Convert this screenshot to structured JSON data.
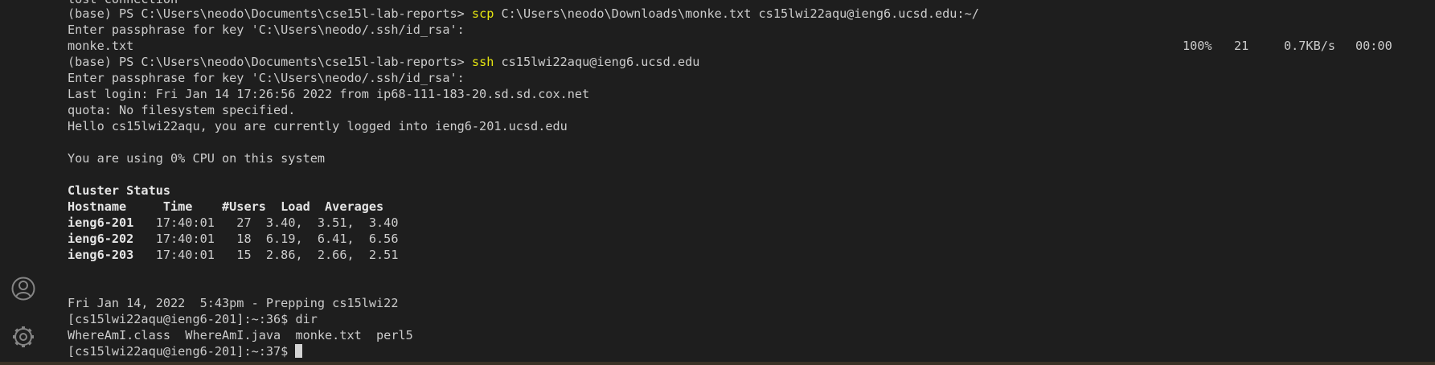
{
  "activity_bar": {
    "icons": [
      "account-icon",
      "settings-gear-icon"
    ]
  },
  "terminal": {
    "top_cut_line": "lost connection",
    "scp_prompt": "(base) PS C:\\Users\\neodo\\Documents\\cse15l-lab-reports>",
    "scp_cmd": "scp",
    "scp_args": "C:\\Users\\neodo\\Downloads\\monke.txt cs15lwi22aqu@ieng6.ucsd.edu:~/",
    "passphrase_1": "Enter passphrase for key 'C:\\Users\\neodo/.ssh/id_rsa':",
    "transfer_file": "monke.txt",
    "transfer_stats": {
      "percent": "100%",
      "bytes": "21",
      "rate": "0.7KB/s",
      "eta": "00:00"
    },
    "ssh_prompt": "(base) PS C:\\Users\\neodo\\Documents\\cse15l-lab-reports>",
    "ssh_cmd": "ssh",
    "ssh_args": "cs15lwi22aqu@ieng6.ucsd.edu",
    "passphrase_2": "Enter passphrase for key 'C:\\Users\\neodo/.ssh/id_rsa':",
    "last_login": "Last login: Fri Jan 14 17:26:56 2022 from ip68-111-183-20.sd.sd.cox.net",
    "quota": "quota: No filesystem specified.",
    "hello": "Hello cs15lwi22aqu, you are currently logged into ieng6-201.ucsd.edu",
    "cpu": "You are using 0% CPU on this system",
    "cluster_title": "Cluster Status",
    "cluster_header": "Hostname     Time    #Users  Load  Averages",
    "cluster_rows": [
      {
        "host": "ieng6-201",
        "rest": "   17:40:01   27  3.40,  3.51,  3.40"
      },
      {
        "host": "ieng6-202",
        "rest": "   17:40:01   18  6.19,  6.41,  6.56"
      },
      {
        "host": "ieng6-203",
        "rest": "   17:40:01   15  2.86,  2.66,  2.51"
      }
    ],
    "prepping": "Fri Jan 14, 2022  5:43pm - Prepping cs15lwi22",
    "prompt_36": "[cs15lwi22aqu@ieng6-201]:~:36$ dir",
    "dir_output": "WhereAmI.class  WhereAmI.java  monke.txt  perl5",
    "prompt_37": "[cs15lwi22aqu@ieng6-201]:~:37$"
  }
}
